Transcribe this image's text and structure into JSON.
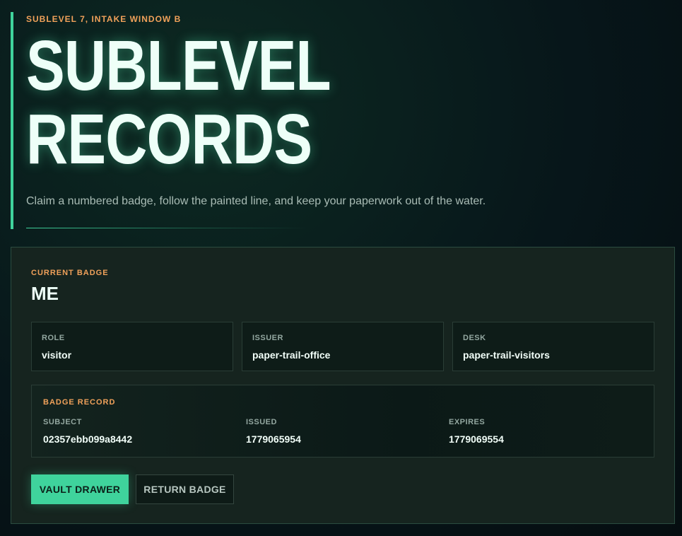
{
  "hero": {
    "eyebrow": "SUBLEVEL 7, INTAKE WINDOW B",
    "title_line1": "SUBLEVEL",
    "title_line2": "RECORDS",
    "subtitle": "Claim a numbered badge, follow the painted line, and keep your paperwork out of the water."
  },
  "badge": {
    "eyebrow": "CURRENT BADGE",
    "name": "ME",
    "fields": [
      {
        "label": "ROLE",
        "value": "visitor"
      },
      {
        "label": "ISSUER",
        "value": "paper-trail-office"
      },
      {
        "label": "DESK",
        "value": "paper-trail-visitors"
      }
    ]
  },
  "record": {
    "eyebrow": "BADGE RECORD",
    "columns": [
      {
        "label": "SUBJECT",
        "value": "02357ebb099a8442"
      },
      {
        "label": "ISSUED",
        "value": "1779065954"
      },
      {
        "label": "EXPIRES",
        "value": "1779069554"
      }
    ]
  },
  "actions": {
    "primary_label": "VAULT DRAWER",
    "secondary_label": "RETURN BADGE"
  },
  "colors": {
    "accent": "#3fd39c",
    "eyebrow": "#f0a15a",
    "background": "#07161a",
    "panel": "#16241f"
  }
}
